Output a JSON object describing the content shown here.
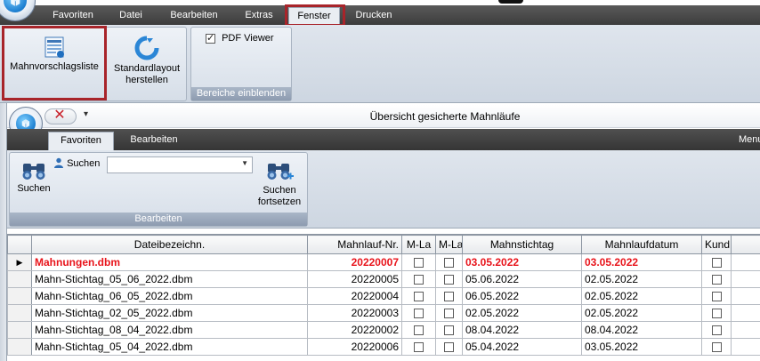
{
  "outer_menu": {
    "tabs": [
      {
        "label": "Favoriten"
      },
      {
        "label": "Datei"
      },
      {
        "label": "Bearbeiten"
      },
      {
        "label": "Extras"
      },
      {
        "label": "Fenster"
      },
      {
        "label": "Drucken"
      }
    ],
    "active_tab": "Fenster"
  },
  "outer_ribbon": {
    "mahnvorschlagsliste": "Mahnvorschlagsliste",
    "standardlayout_line1": "Standardlayout",
    "standardlayout_line2": "herstellen",
    "pdf_viewer": "PDF Viewer",
    "pdf_viewer_checked": true,
    "group_bereiche": "Bereiche einblenden"
  },
  "inner_window": {
    "title": "Übersicht gesicherte Mahnläufe",
    "tabs": [
      {
        "label": "Favoriten"
      },
      {
        "label": "Bearbeiten"
      }
    ],
    "active_tab": "Favoriten",
    "menus_label": "Menus"
  },
  "inner_ribbon": {
    "suchen_label": "Suchen",
    "search_value": "",
    "suchen_button": "Suchen",
    "suchen_fortsetzen_line1": "Suchen",
    "suchen_fortsetzen_line2": "fortsetzen",
    "group_bearbeiten": "Bearbeiten"
  },
  "grid": {
    "columns": [
      "Dateibezeichn.",
      "Mahnlauf-Nr.",
      "M-La",
      "M-La",
      "Mahnstichtag",
      "Mahnlaufdatum",
      "Kund"
    ],
    "rows": [
      {
        "file": "Mahnungen.dbm",
        "nr": "20220007",
        "stichtag": "03.05.2022",
        "datum": "03.05.2022",
        "current": true,
        "highlight": true
      },
      {
        "file": "Mahn-Stichtag_05_06_2022.dbm",
        "nr": "20220005",
        "stichtag": "05.06.2022",
        "datum": "02.05.2022",
        "current": false,
        "highlight": false
      },
      {
        "file": "Mahn-Stichtag_06_05_2022.dbm",
        "nr": "20220004",
        "stichtag": "06.05.2022",
        "datum": "02.05.2022",
        "current": false,
        "highlight": false
      },
      {
        "file": "Mahn-Stichtag_02_05_2022.dbm",
        "nr": "20220003",
        "stichtag": "02.05.2022",
        "datum": "02.05.2022",
        "current": false,
        "highlight": false
      },
      {
        "file": "Mahn-Stichtag_08_04_2022.dbm",
        "nr": "20220002",
        "stichtag": "08.04.2022",
        "datum": "08.04.2022",
        "current": false,
        "highlight": false
      },
      {
        "file": "Mahn-Stichtag_05_04_2022.dbm",
        "nr": "20220006",
        "stichtag": "05.04.2022",
        "datum": "03.05.2022",
        "current": false,
        "highlight": false
      }
    ]
  },
  "colors": {
    "highlight_red": "#e8141b",
    "callout_red": "#a8242a",
    "menubar_dark": "#3c3c3c"
  }
}
